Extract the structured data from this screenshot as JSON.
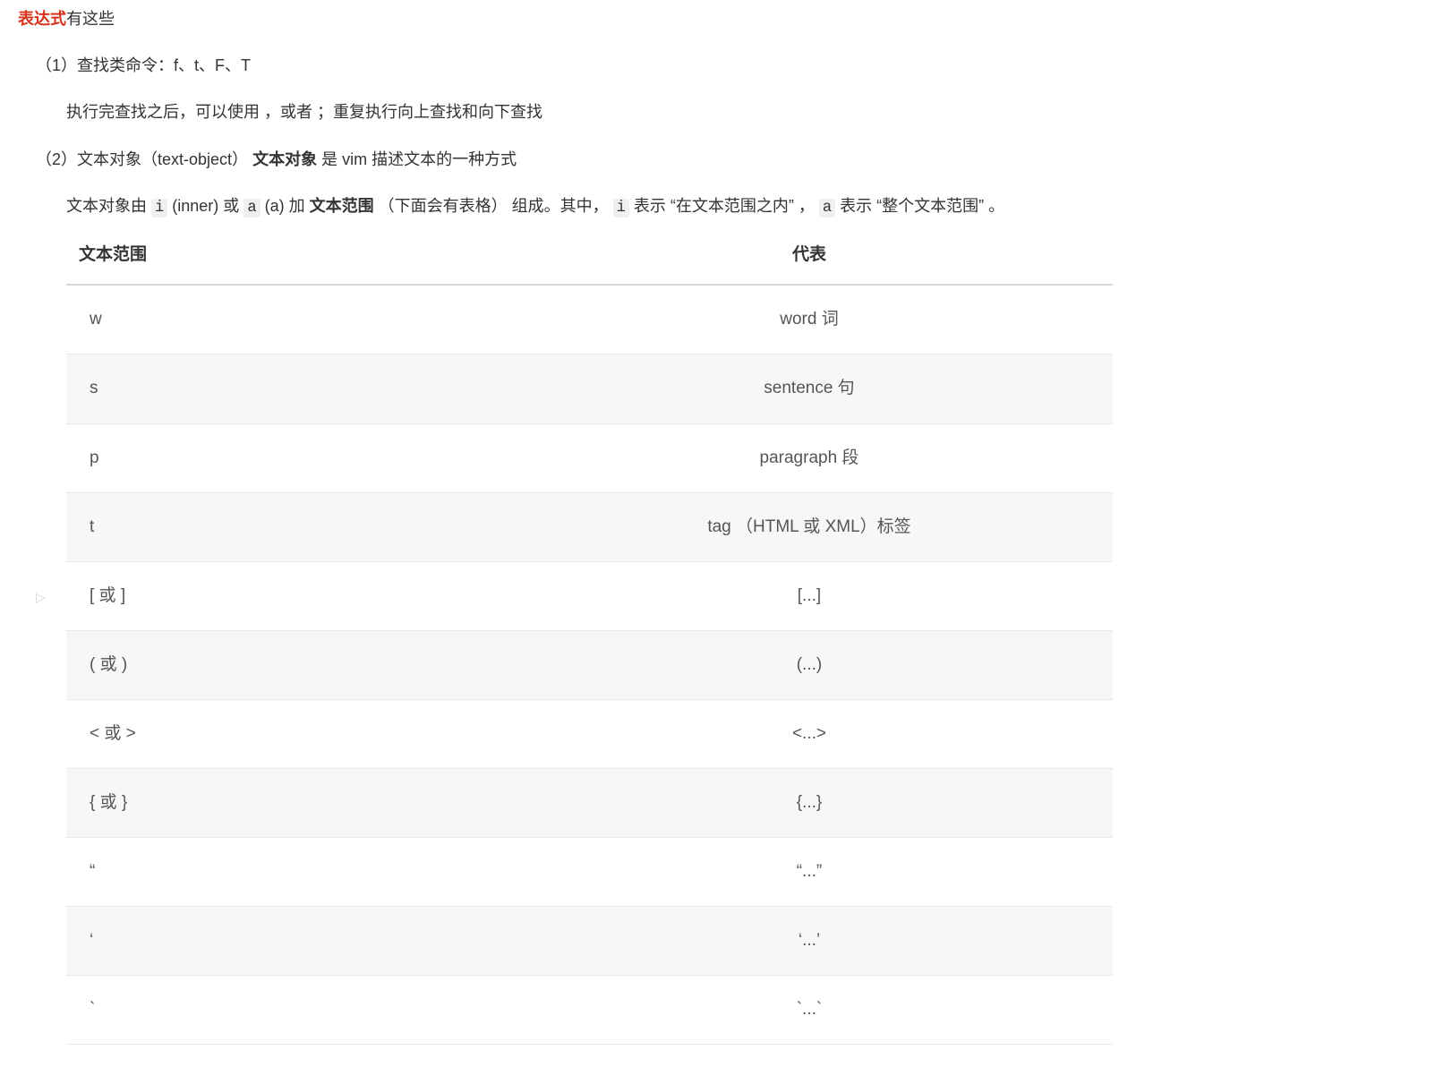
{
  "heading": {
    "red": "表达式",
    "rest": "有这些"
  },
  "item1": {
    "label": "（1）查找类命令：f、t、F、T",
    "note": "执行完查找之后，可以使用 ，或者 ；重复执行向上查找和向下查找"
  },
  "item2": {
    "label_pre": "（2）文本对象（text-object）",
    "label_bold": "文本对象",
    "label_post": " 是 vim 描述文本的一种方式",
    "desc_pre": "文本对象由 ",
    "code_i": "i",
    "desc_inner": " (inner) 或 ",
    "code_a": "a",
    "desc_a": " (a) 加 ",
    "desc_bold": "文本范围",
    "desc_paren": "  （下面会有表格） 组成。其中， ",
    "code_i2": "i",
    "desc_i2": " 表示 “在文本范围之内” ， ",
    "code_a2": "a",
    "desc_a2": " 表示 “整个文本范围” 。"
  },
  "table": {
    "header": {
      "col1": "文本范围",
      "col2": "代表"
    },
    "rows": [
      {
        "c1": "w",
        "c2": "word 词"
      },
      {
        "c1": "s",
        "c2": "sentence 句"
      },
      {
        "c1": "p",
        "c2": "paragraph 段"
      },
      {
        "c1": "t",
        "c2": "tag （HTML 或 XML）标签"
      },
      {
        "c1": "[ 或 ]",
        "c2": "[...]"
      },
      {
        "c1": "( 或 )",
        "c2": "(...)"
      },
      {
        "c1": "< 或 >",
        "c2": "<...>"
      },
      {
        "c1": "{ 或 }",
        "c2": "{...}"
      },
      {
        "c1": "“",
        "c2": "“...”"
      },
      {
        "c1": "‘",
        "c2": "‘...’"
      },
      {
        "c1": "`",
        "c2": "`...`"
      }
    ]
  },
  "marker_row_index": 4
}
